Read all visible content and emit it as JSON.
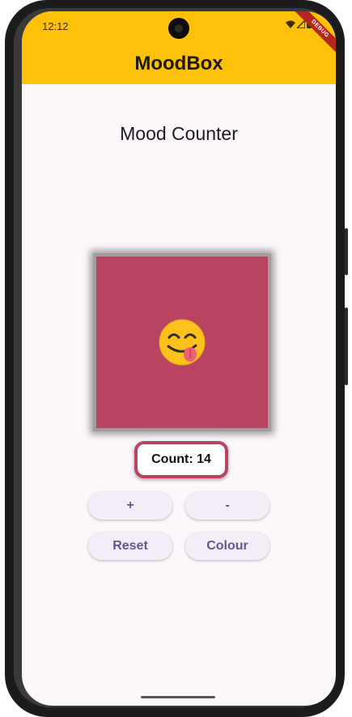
{
  "status_bar": {
    "time": "12:12"
  },
  "debug_banner": "DEBUG",
  "appbar": {
    "title": "MoodBox"
  },
  "main": {
    "heading": "Mood Counter",
    "mood_emoji": "face-savoring-food",
    "count_label": "Count: 14",
    "buttons": {
      "increment": "+",
      "decrement": "-",
      "reset": "Reset",
      "colour": "Colour"
    }
  },
  "colors": {
    "appbar": "#ffc107",
    "mood_box": "#b84462",
    "button_text": "#65558f",
    "background": "#fdf6fb"
  }
}
